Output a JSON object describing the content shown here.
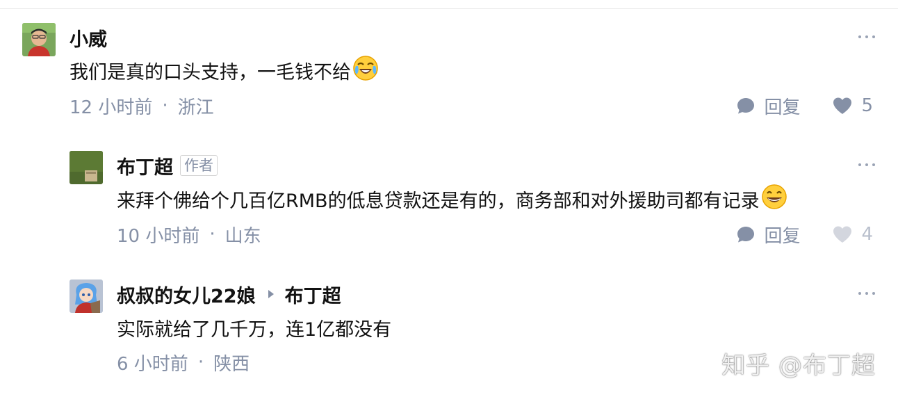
{
  "comments": [
    {
      "author": "小威",
      "text": "我们是真的口头支持，一毛钱不给",
      "time": "12 小时前",
      "location": "浙江",
      "reply_label": "回复",
      "likes": "5"
    },
    {
      "author": "布丁超",
      "badge": "作者",
      "text": "来拜个佛给个几百亿RMB的低息贷款还是有的，商务部和对外援助司都有记录",
      "time": "10 小时前",
      "location": "山东",
      "reply_label": "回复",
      "likes": "4"
    },
    {
      "author": "叔叔的女儿22娘",
      "reply_to": "布丁超",
      "text": "实际就给了几千万，连1亿都没有",
      "time": "6 小时前",
      "location": "陕西"
    }
  ],
  "meta_separator": "·",
  "watermark": "知乎 @布丁超",
  "colors": {
    "text_primary": "#121212",
    "text_secondary": "#8590a6",
    "like_active": "#8590a6",
    "like_inactive": "#d3d6de"
  },
  "icons": {
    "more": "more-dots-icon",
    "reply": "comment-bubble-icon",
    "like": "heart-icon",
    "emoji_1": "crying-laughing-emoji",
    "emoji_2": "grinning-emoji"
  }
}
